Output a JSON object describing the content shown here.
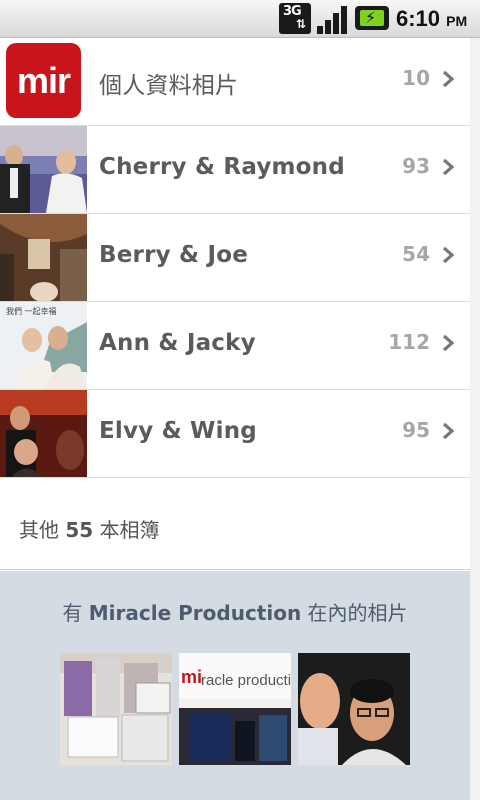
{
  "status_bar": {
    "network": "3G",
    "time": "6:10",
    "ampm": "PM",
    "colors": {
      "battery_fill": "#7ed321"
    }
  },
  "albums": [
    {
      "label": "個人資料相片",
      "count": "10",
      "icon": "mir-logo"
    },
    {
      "label": "Cherry & Raymond",
      "count": "93"
    },
    {
      "label": "Berry & Joe",
      "count": "54"
    },
    {
      "label": "Ann & Jacky",
      "count": "112"
    },
    {
      "label": "Elvy & Wing",
      "count": "95"
    }
  ],
  "logo_text": "mir",
  "more": {
    "prefix": "其他 ",
    "count": "55",
    "suffix": " 本相簿"
  },
  "tagged": {
    "prefix": "有 ",
    "name": "Miracle Production",
    "suffix": " 在內的相片"
  },
  "accent_color": "#c8151b"
}
